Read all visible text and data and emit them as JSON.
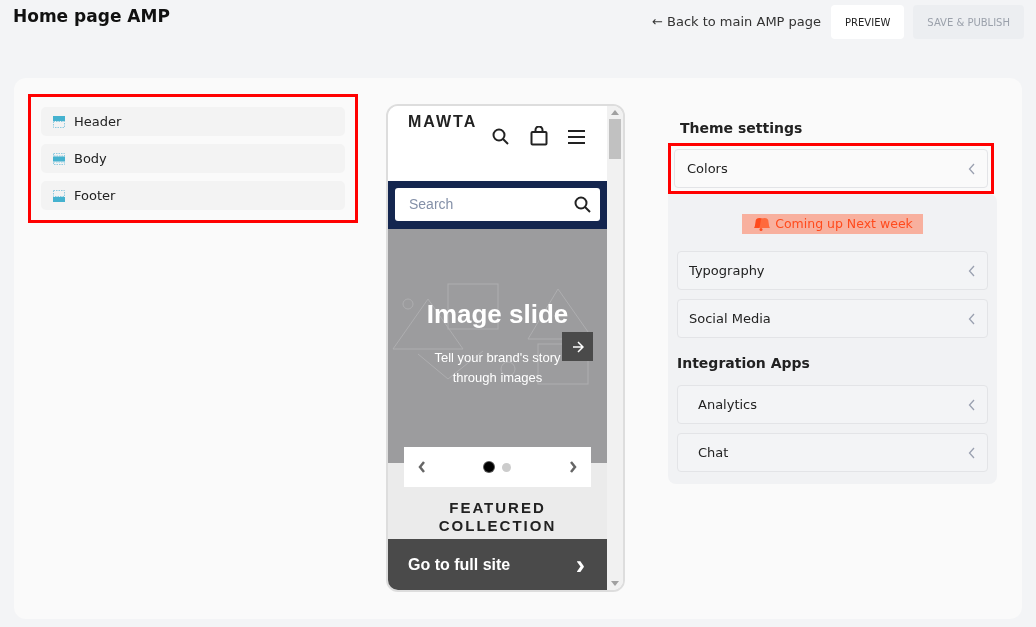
{
  "page_title": "Home page AMP",
  "back_link": "← Back to main AMP page",
  "buttons": [
    {
      "label": "PREVIEW",
      "disabled": false
    },
    {
      "label": "SAVE & PUBLISH",
      "disabled": true
    }
  ],
  "sections": {
    "highlighted": true,
    "items": [
      {
        "label": "Header",
        "kind": "header"
      },
      {
        "label": "Body",
        "kind": "body"
      },
      {
        "label": "Footer",
        "kind": "footer"
      }
    ]
  },
  "preview": {
    "logo": "MAWTA",
    "search_placeholder": "Search",
    "slide_title": "Image slide",
    "slide_text": "Tell your brand's story through images",
    "slides": [
      {
        "selected": true
      },
      {
        "selected": false
      }
    ],
    "featured_heading": "FEATURED COLLECTION",
    "full_site_button": "Go to full site",
    "full_site_arrow": "›"
  },
  "theme_settings": {
    "title": "Theme settings",
    "items": [
      {
        "label": "Colors",
        "highlighted": true
      }
    ],
    "notice": "Coming up Next week",
    "upcoming_items": [
      {
        "label": "Typography"
      },
      {
        "label": "Social Media"
      }
    ]
  },
  "integration_apps": {
    "title": "Integration Apps",
    "items": [
      {
        "label": "Analytics"
      },
      {
        "label": "Chat"
      }
    ]
  }
}
